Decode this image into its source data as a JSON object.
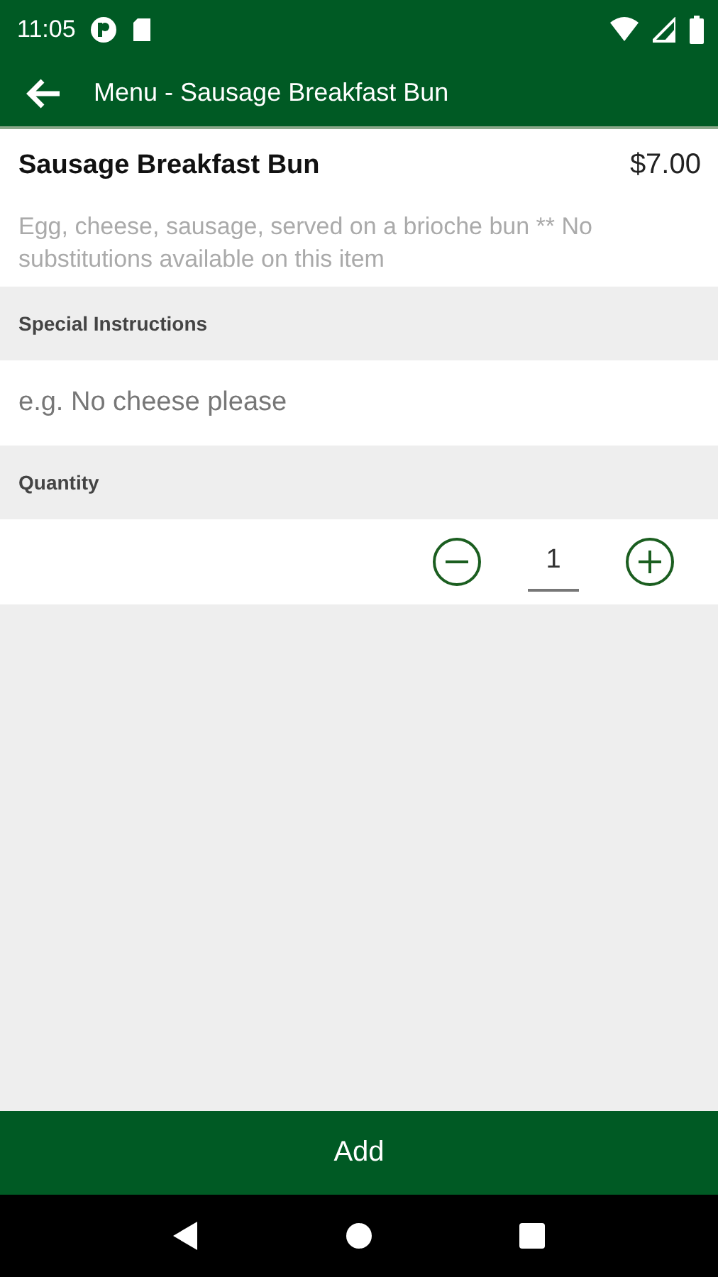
{
  "status_bar": {
    "time": "11:05"
  },
  "toolbar": {
    "title": "Menu - Sausage Breakfast Bun"
  },
  "item": {
    "name": "Sausage Breakfast Bun",
    "price": "$7.00",
    "description": "Egg, cheese, sausage, served on a brioche bun ** No substitutions available on this item"
  },
  "special_instructions": {
    "label": "Special Instructions",
    "placeholder": "e.g. No cheese please"
  },
  "quantity": {
    "label": "Quantity",
    "value": "1"
  },
  "add_button": "Add"
}
